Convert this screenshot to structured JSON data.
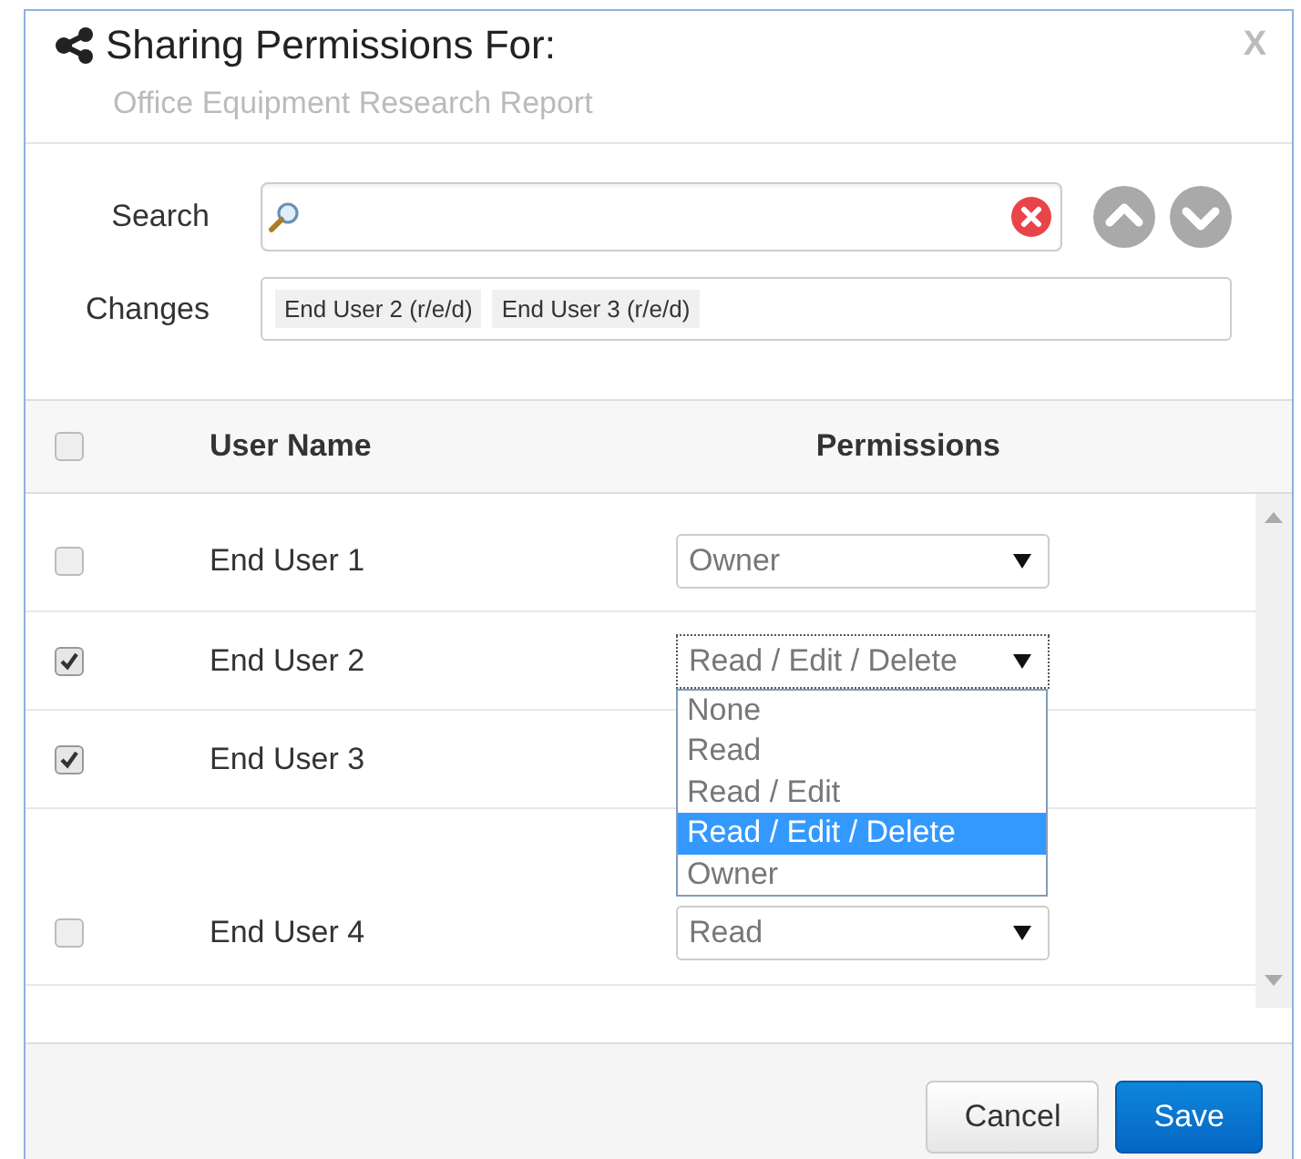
{
  "dialog": {
    "title": "Sharing Permissions For:",
    "subtitle": "Office Equipment Research Report",
    "close": "X"
  },
  "search": {
    "label": "Search"
  },
  "changes": {
    "label": "Changes",
    "items": [
      "End User 2 (r/e/d)",
      "End User 3 (r/e/d)"
    ]
  },
  "table": {
    "header": {
      "checked": false
    },
    "columns": [
      "User Name",
      "Permissions"
    ],
    "rows": [
      {
        "checked": false,
        "name": "End User 1",
        "permission": "Owner"
      },
      {
        "checked": true,
        "name": "End User 2",
        "permission": "Read / Edit / Delete",
        "dropdown": [
          {
            "label": "None",
            "selected": false
          },
          {
            "label": "Read",
            "selected": false
          },
          {
            "label": "Read / Edit",
            "selected": false
          },
          {
            "label": "Read / Edit / Delete",
            "selected": true
          },
          {
            "label": "Owner",
            "selected": false
          }
        ]
      },
      {
        "checked": true,
        "name": "End User 3"
      },
      {
        "checked": false,
        "name": "End User 4",
        "permission": "Read"
      }
    ]
  },
  "buttons": [
    {
      "label": "Cancel",
      "kind": "secondary"
    },
    {
      "label": "Save",
      "kind": "primary"
    }
  ]
}
